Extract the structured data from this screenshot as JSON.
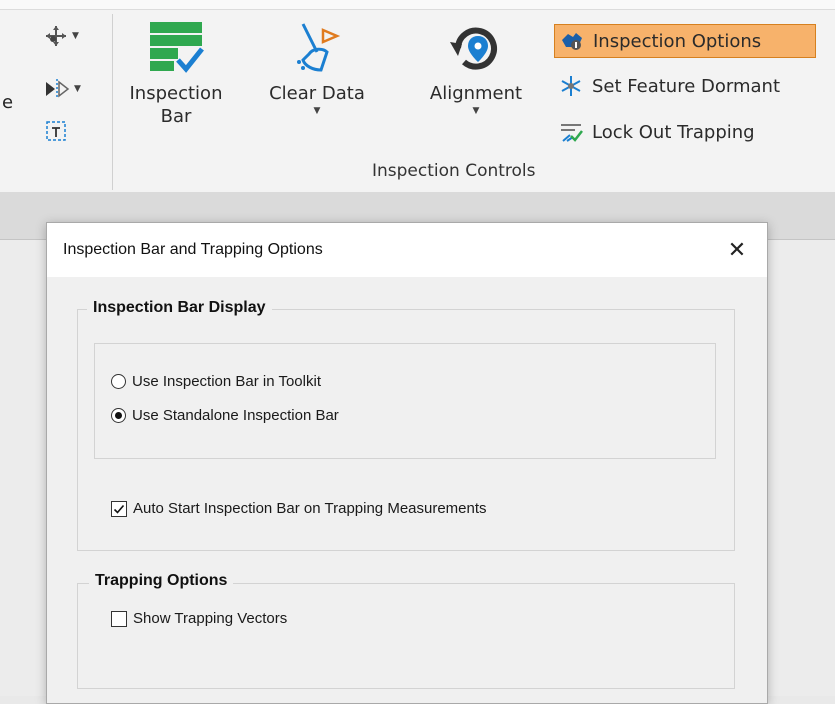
{
  "ribbon": {
    "left_fragment": "e",
    "buttons": {
      "inspection_bar": {
        "line1": "Inspection",
        "line2": "Bar"
      },
      "clear_data": {
        "label": "Clear Data"
      },
      "alignment": {
        "label": "Alignment"
      }
    },
    "small_buttons": [
      {
        "label": "Inspection Options",
        "icon": "inspection-options-icon",
        "active": true
      },
      {
        "label": "Set Feature Dormant",
        "icon": "snowflake-icon"
      },
      {
        "label": "Lock Out Trapping",
        "icon": "lock-out-trapping-icon"
      }
    ],
    "group_label": "Inspection Controls",
    "colors": {
      "active_bg": "#f7b26b",
      "active_border": "#d6801f",
      "green": "#2fa84f",
      "blue": "#1b7fd1"
    }
  },
  "dialog": {
    "title": "Inspection Bar and Trapping Options",
    "close_glyph": "✕",
    "inspection_bar_display": {
      "caption": "Inspection Bar Display",
      "radio_options": [
        {
          "label": "Use Inspection Bar in Toolkit",
          "selected": false
        },
        {
          "label": "Use Standalone Inspection Bar",
          "selected": true
        }
      ],
      "auto_start": {
        "label": "Auto Start Inspection Bar on Trapping Measurements",
        "checked": true
      }
    },
    "trapping_options": {
      "caption": "Trapping Options",
      "show_vectors": {
        "label": "Show Trapping Vectors",
        "checked": false
      }
    }
  }
}
